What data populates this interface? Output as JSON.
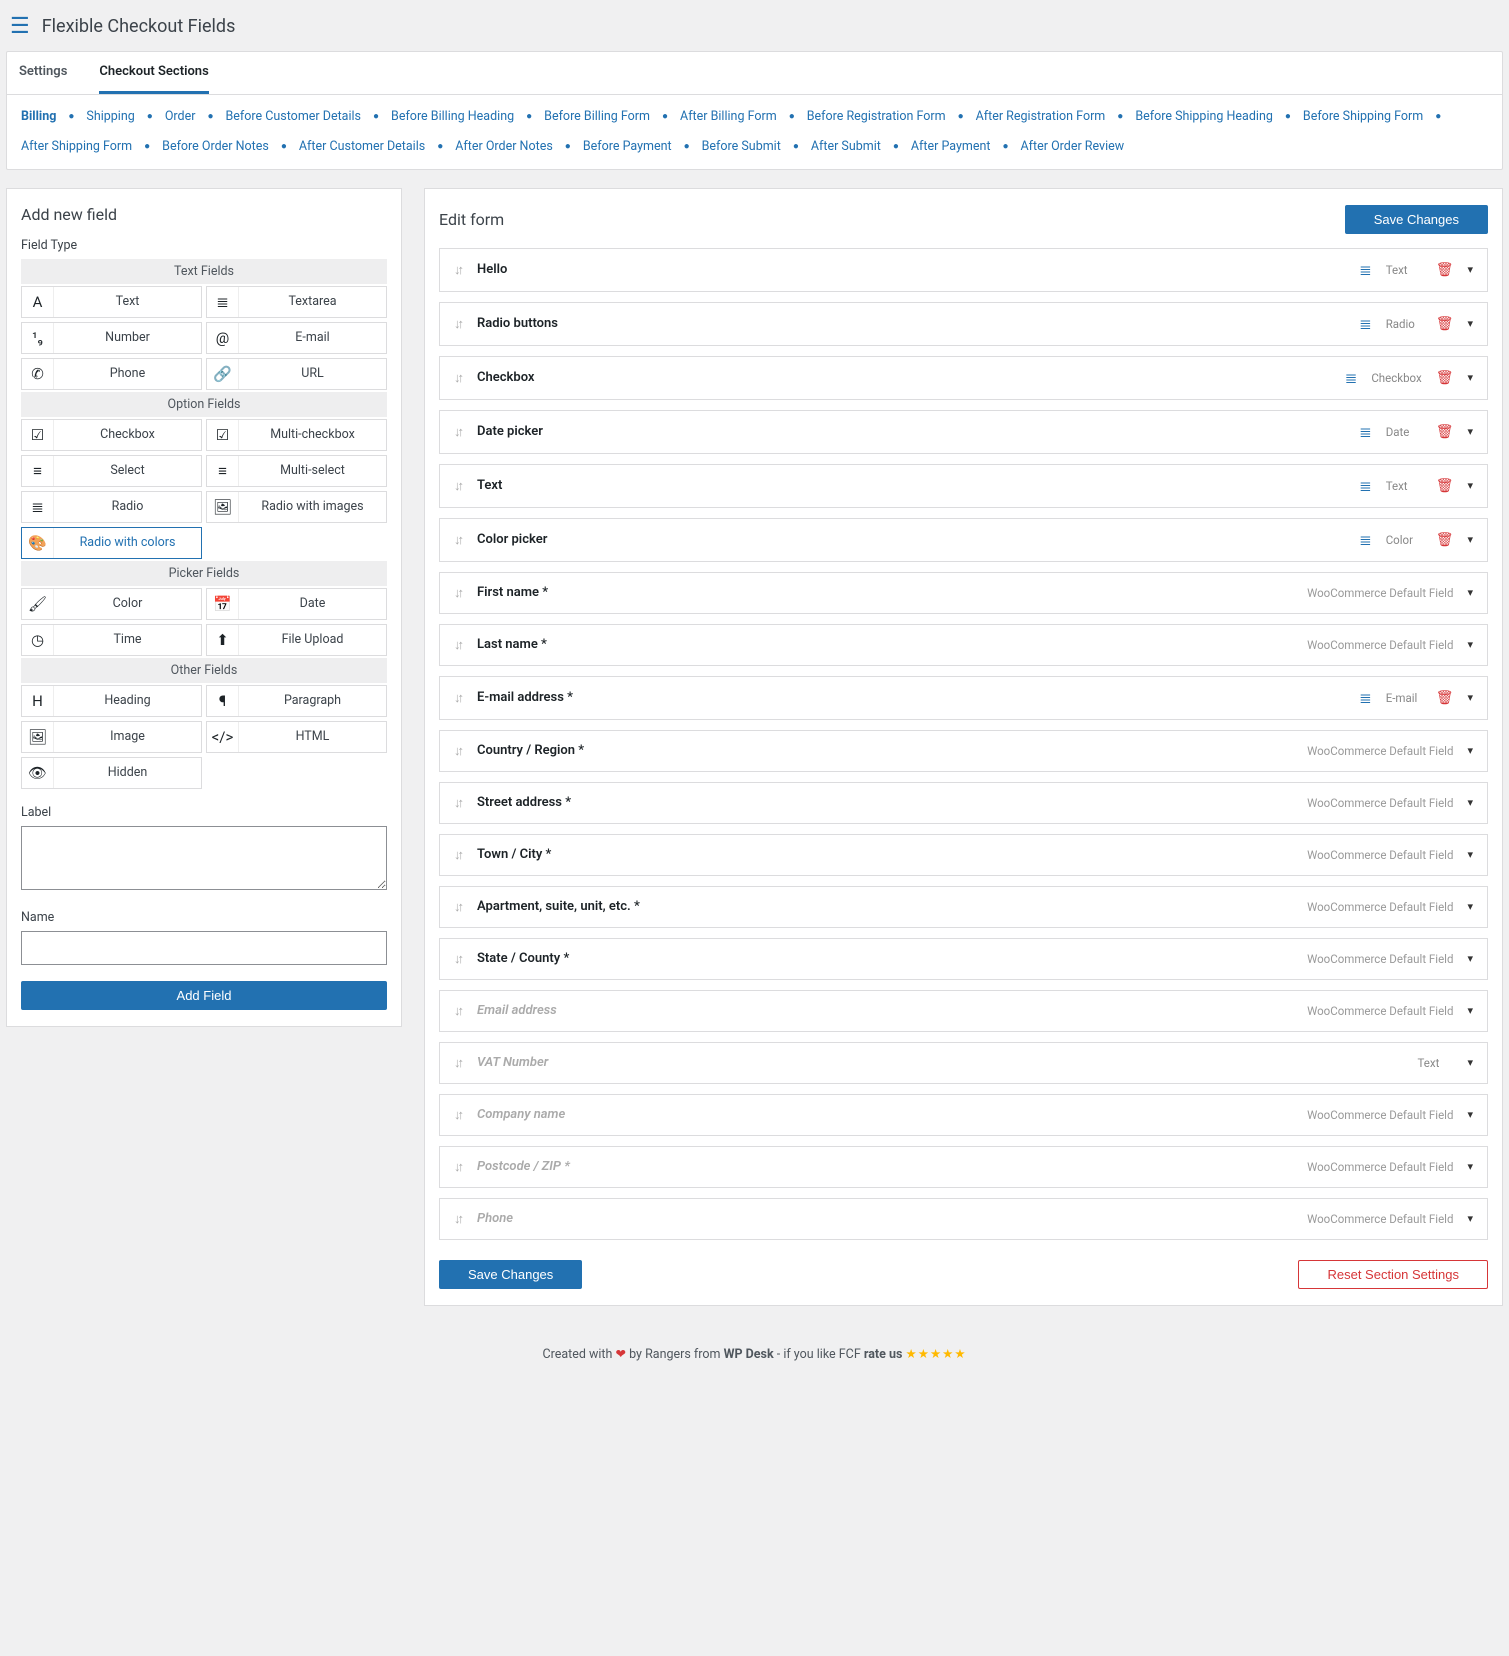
{
  "header": {
    "title": "Flexible Checkout Fields"
  },
  "tabs": {
    "settings": "Settings",
    "sections": "Checkout Sections"
  },
  "section_links": [
    "Billing",
    "Shipping",
    "Order",
    "Before Customer Details",
    "Before Billing Heading",
    "Before Billing Form",
    "After Billing Form",
    "Before Registration Form",
    "After Registration Form",
    "Before Shipping Heading",
    "Before Shipping Form",
    "After Shipping Form",
    "Before Order Notes",
    "After Customer Details",
    "After Order Notes",
    "Before Payment",
    "Before Submit",
    "After Submit",
    "After Payment",
    "After Order Review"
  ],
  "add_panel": {
    "title": "Add new field",
    "field_type_label": "Field Type",
    "label_label": "Label",
    "name_label": "Name",
    "add_button": "Add Field",
    "groups": [
      {
        "title": "Text Fields",
        "options": [
          {
            "icon": "A",
            "label": "Text",
            "name": "text"
          },
          {
            "icon": "≣",
            "label": "Textarea",
            "name": "textarea"
          },
          {
            "icon": "¹₉",
            "label": "Number",
            "name": "number"
          },
          {
            "icon": "@",
            "label": "E-mail",
            "name": "email"
          },
          {
            "icon": "✆",
            "label": "Phone",
            "name": "phone"
          },
          {
            "icon": "🔗",
            "label": "URL",
            "name": "url"
          }
        ]
      },
      {
        "title": "Option Fields",
        "options": [
          {
            "icon": "☑",
            "label": "Checkbox",
            "name": "checkbox"
          },
          {
            "icon": "☑",
            "label": "Multi-checkbox",
            "name": "multi-checkbox"
          },
          {
            "icon": "≡",
            "label": "Select",
            "name": "select"
          },
          {
            "icon": "≡",
            "label": "Multi-select",
            "name": "multi-select"
          },
          {
            "icon": "≣",
            "label": "Radio",
            "name": "radio"
          },
          {
            "icon": "🖼",
            "label": "Radio with images",
            "name": "radio-images"
          },
          {
            "icon": "🎨",
            "label": "Radio with colors",
            "name": "radio-colors",
            "selected": true
          }
        ]
      },
      {
        "title": "Picker Fields",
        "options": [
          {
            "icon": "🖌",
            "label": "Color",
            "name": "color"
          },
          {
            "icon": "📅",
            "label": "Date",
            "name": "date"
          },
          {
            "icon": "◷",
            "label": "Time",
            "name": "time"
          },
          {
            "icon": "⬆",
            "label": "File Upload",
            "name": "file-upload"
          }
        ]
      },
      {
        "title": "Other Fields",
        "options": [
          {
            "icon": "H",
            "label": "Heading",
            "name": "heading"
          },
          {
            "icon": "¶",
            "label": "Paragraph",
            "name": "paragraph"
          },
          {
            "icon": "🖼",
            "label": "Image",
            "name": "image"
          },
          {
            "icon": "</>",
            "label": "HTML",
            "name": "html"
          },
          {
            "icon": "👁",
            "label": "Hidden",
            "name": "hidden"
          }
        ]
      }
    ]
  },
  "edit_panel": {
    "title": "Edit form",
    "save_button": "Save Changes",
    "reset_button": "Reset Section Settings",
    "default_label": "WooCommerce Default Field",
    "fields": [
      {
        "label": "Hello",
        "type": "Text",
        "deletable": true
      },
      {
        "label": "Radio buttons",
        "type": "Radio",
        "deletable": true
      },
      {
        "label": "Checkbox",
        "type": "Checkbox",
        "deletable": true
      },
      {
        "label": "Date picker",
        "type": "Date",
        "deletable": true
      },
      {
        "label": "Text",
        "type": "Text",
        "deletable": true
      },
      {
        "label": "Color picker",
        "type": "Color",
        "deletable": true
      },
      {
        "label": "First name *",
        "default": true
      },
      {
        "label": "Last name *",
        "default": true
      },
      {
        "label": "E-mail address *",
        "type": "E-mail",
        "deletable": true
      },
      {
        "label": "Country / Region *",
        "default": true
      },
      {
        "label": "Street address *",
        "default": true
      },
      {
        "label": "Town / City *",
        "default": true
      },
      {
        "label": "Apartment, suite, unit, etc. *",
        "default": true
      },
      {
        "label": "State / County *",
        "default": true
      },
      {
        "label": "Email address",
        "default": true,
        "disabled": true
      },
      {
        "label": "VAT Number",
        "type": "Text",
        "disabled": true,
        "type_only": true
      },
      {
        "label": "Company name",
        "default": true,
        "disabled": true
      },
      {
        "label": "Postcode / ZIP *",
        "default": true,
        "disabled": true
      },
      {
        "label": "Phone",
        "default": true,
        "disabled": true
      }
    ]
  },
  "footer": {
    "created_with": "Created with",
    "by_rangers": "by Rangers from",
    "wpdesk": "WP Desk",
    "if_like": "- if you like FCF",
    "rate_us": "rate us"
  }
}
